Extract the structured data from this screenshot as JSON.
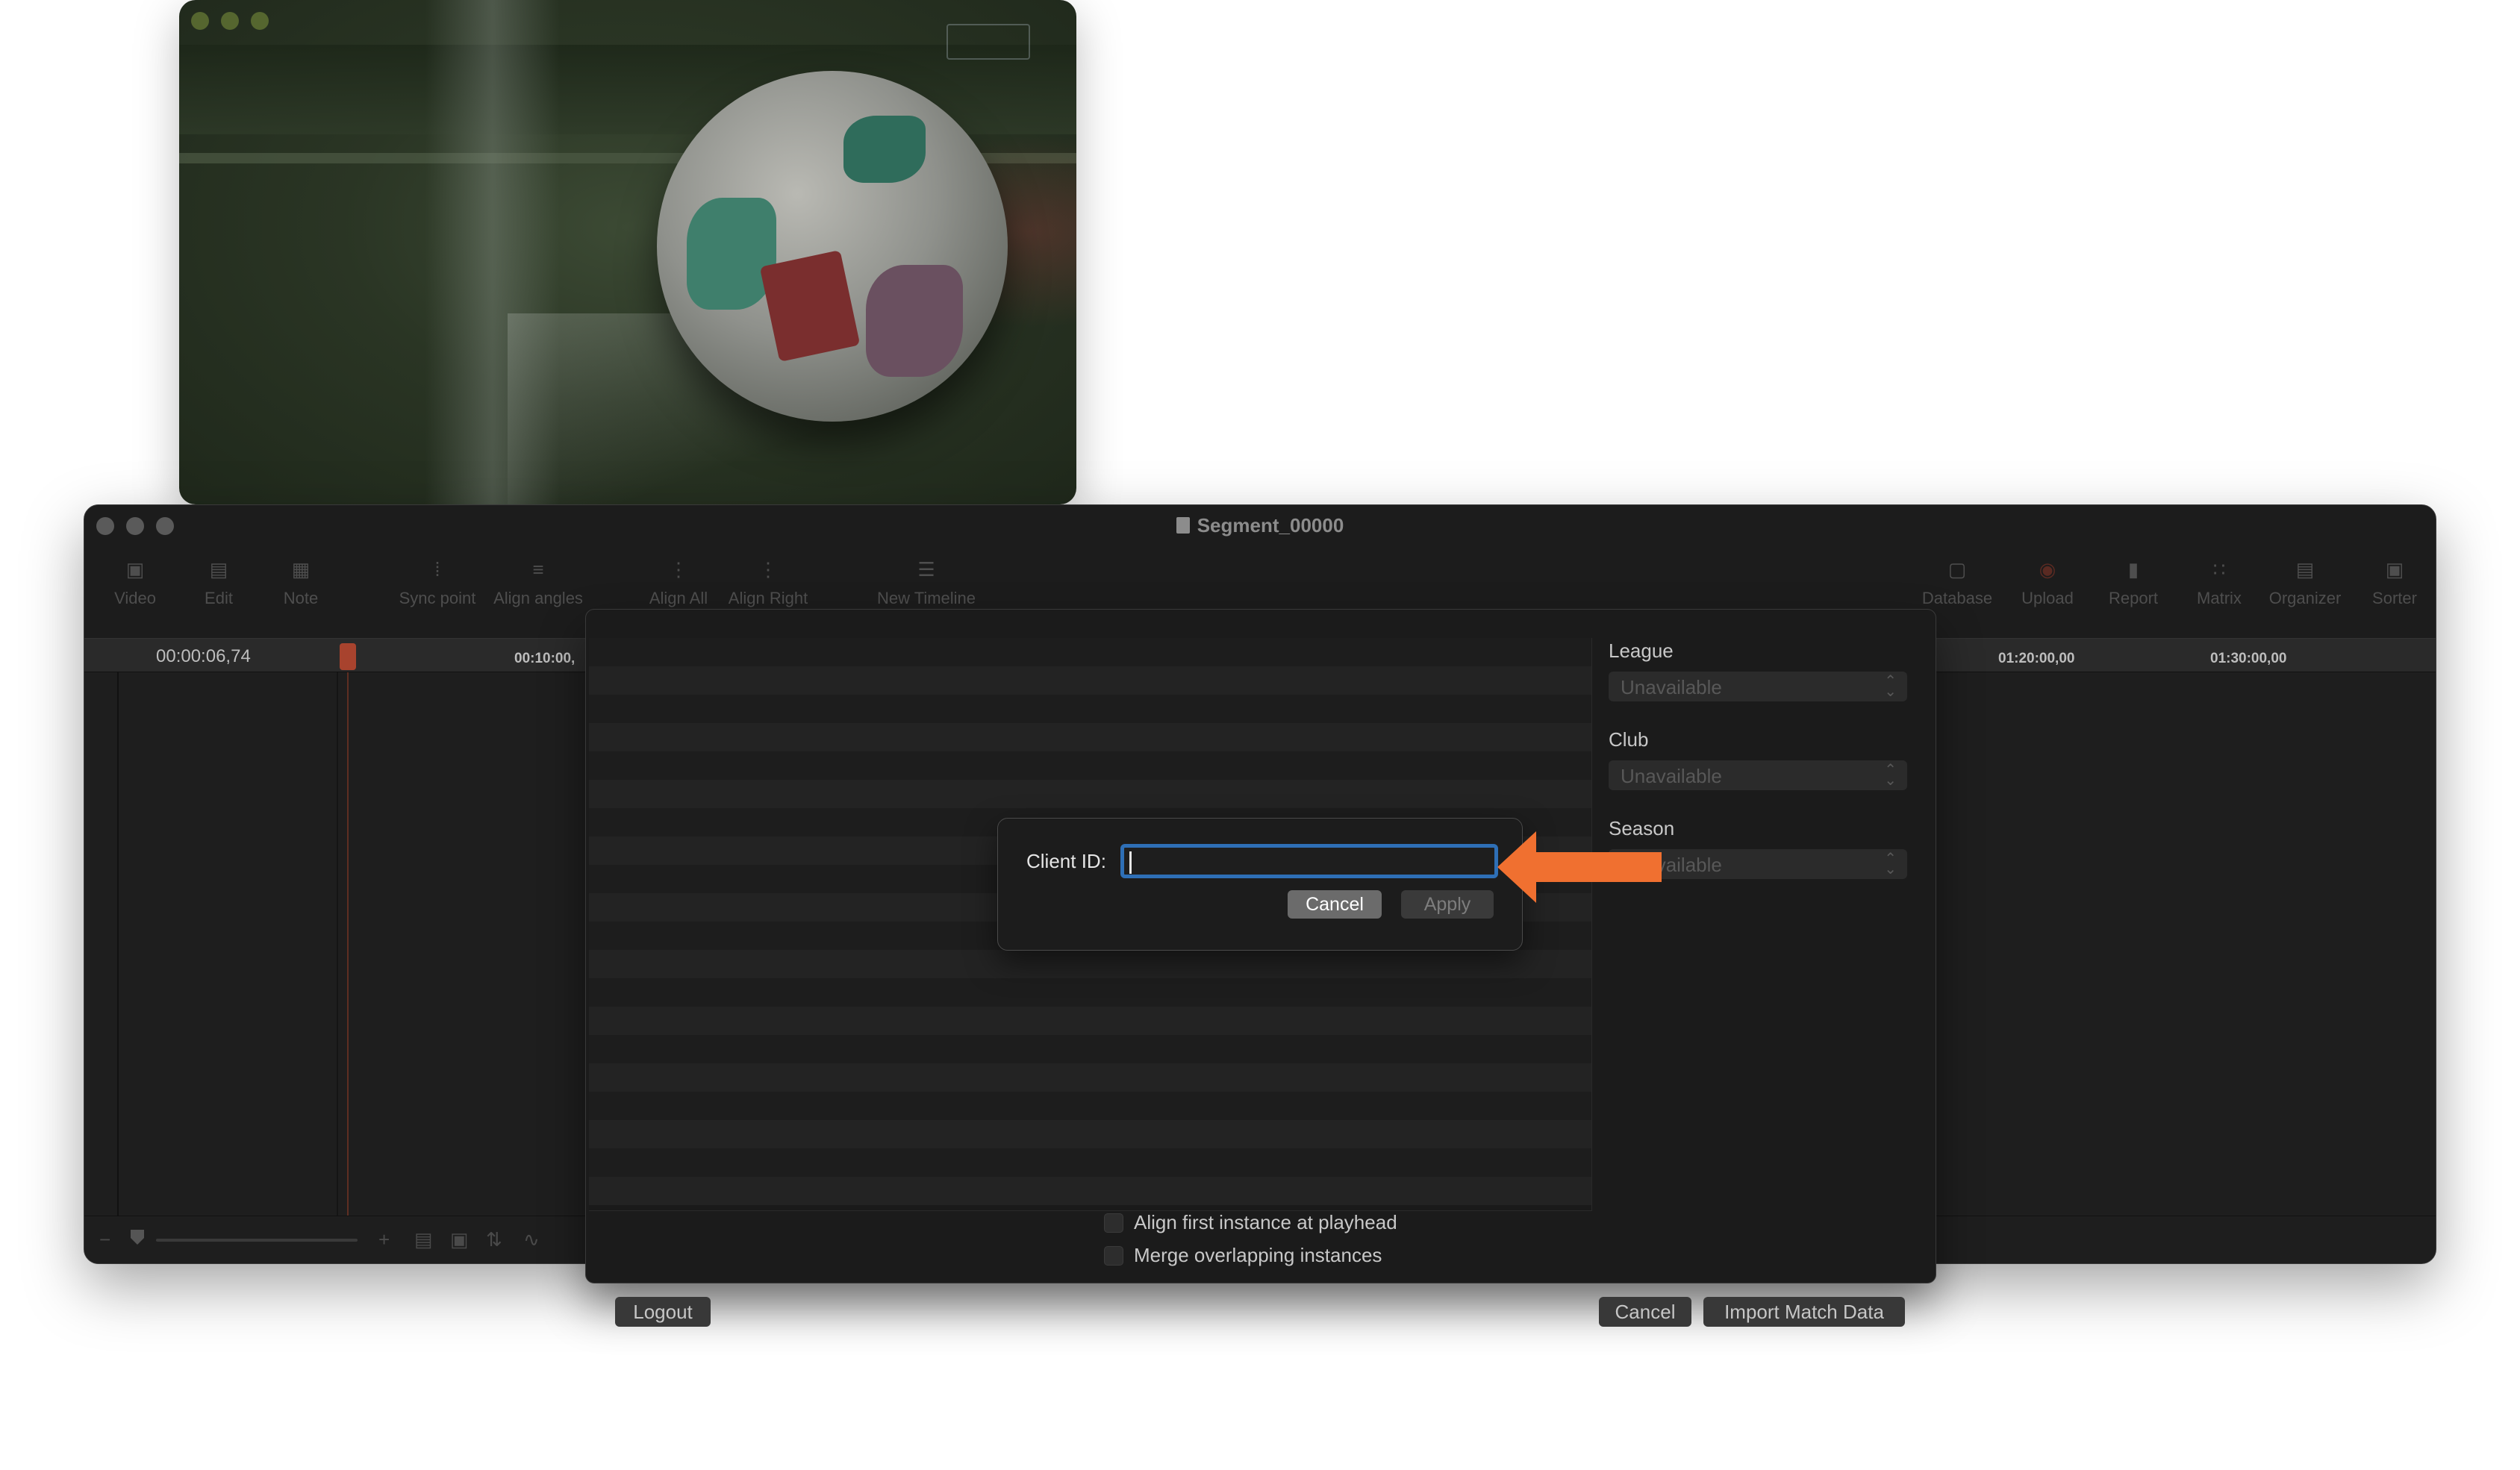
{
  "video_window": {
    "description_icons": [
      "close-dot",
      "minimize-dot",
      "zoom-dot"
    ]
  },
  "app": {
    "title": "Segment_00000",
    "toolbar_left": [
      {
        "label": "Video",
        "icon": "video-icon"
      },
      {
        "label": "Edit",
        "icon": "edit-icon"
      },
      {
        "label": "Note",
        "icon": "note-icon"
      },
      {
        "label": "Sync point",
        "icon": "sync-point-icon"
      },
      {
        "label": "Align angles",
        "icon": "align-angles-icon"
      },
      {
        "label": "Align All",
        "icon": "align-all-icon"
      },
      {
        "label": "Align Right",
        "icon": "align-right-icon"
      },
      {
        "label": "New Timeline",
        "icon": "new-timeline-icon"
      }
    ],
    "toolbar_right": [
      {
        "label": "Database",
        "icon": "database-icon"
      },
      {
        "label": "Upload",
        "icon": "upload-icon"
      },
      {
        "label": "Report",
        "icon": "report-icon"
      },
      {
        "label": "Matrix",
        "icon": "matrix-icon"
      },
      {
        "label": "Organizer",
        "icon": "organizer-icon"
      },
      {
        "label": "Sorter",
        "icon": "sorter-icon"
      }
    ],
    "timeline": {
      "timecode": "00:00:06,74",
      "ruler_labels": [
        "00:10:00,",
        "01:20:00,00",
        "01:30:00,00"
      ]
    }
  },
  "import_sheet": {
    "league_label": "League",
    "league_value": "Unavailable",
    "club_label": "Club",
    "club_value": "Unavailable",
    "season_label": "Season",
    "season_value": "Unavailable",
    "option_align": "Align first instance at playhead",
    "option_merge": "Merge overlapping instances",
    "logout_label": "Logout",
    "cancel_label": "Cancel",
    "import_label": "Import Match Data"
  },
  "client_dialog": {
    "label": "Client ID:",
    "input_value": "",
    "cancel_label": "Cancel",
    "apply_label": "Apply"
  },
  "colors": {
    "focus_ring": "#2e6fb6",
    "annotation_arrow": "#f07030",
    "playhead": "#a8432e"
  }
}
